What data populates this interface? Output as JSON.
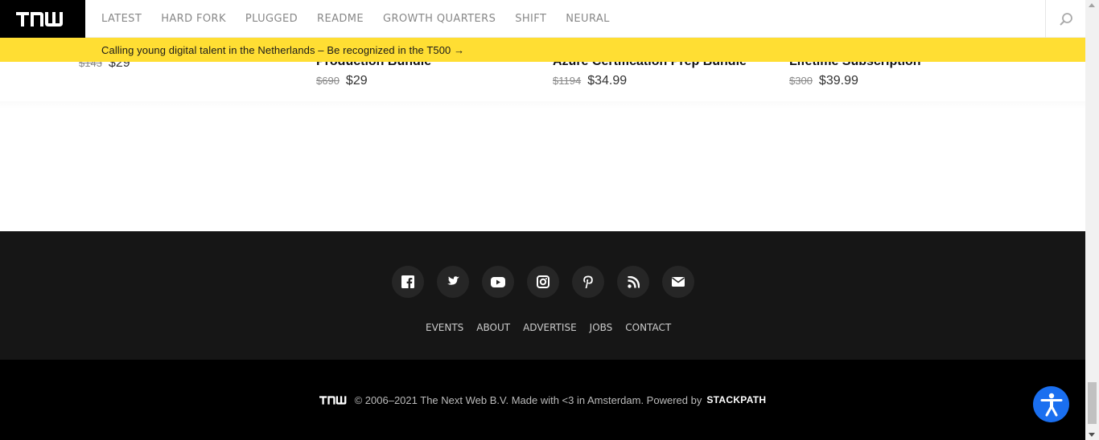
{
  "header": {
    "logo_text": "TNW",
    "nav": [
      "LATEST",
      "HARD FORK",
      "PLUGGED",
      "README",
      "GROWTH QUARTERS",
      "SHIFT",
      "NEURAL"
    ],
    "search_icon": "search-icon"
  },
  "banner": {
    "text": "Calling young digital talent in the Netherlands – Be recognized in the T500 →"
  },
  "deals": [
    {
      "title": "",
      "old_price": "$143",
      "new_price": "$29"
    },
    {
      "title": "Production Bundle",
      "old_price": "$690",
      "new_price": "$29"
    },
    {
      "title": "Azure Certification Prep Bundle",
      "old_price": "$1194",
      "new_price": "$34.99"
    },
    {
      "title": "Lifetime Subscription",
      "old_price": "$300",
      "new_price": "$39.99"
    }
  ],
  "footer": {
    "socials": [
      "facebook-icon",
      "twitter-icon",
      "youtube-icon",
      "instagram-icon",
      "pinterest-icon",
      "rss-icon",
      "email-icon"
    ],
    "links": [
      "EVENTS",
      "ABOUT",
      "ADVERTISE",
      "JOBS",
      "CONTACT"
    ],
    "copyright": "© 2006–2021 The Next Web B.V. Made with <3 in Amsterdam. Powered by",
    "powered_by": "STACKPATH"
  },
  "colors": {
    "banner": "#ffde33",
    "footer": "#161616",
    "footer_bottom": "#000000",
    "accessibility": "#1a6ff0"
  }
}
